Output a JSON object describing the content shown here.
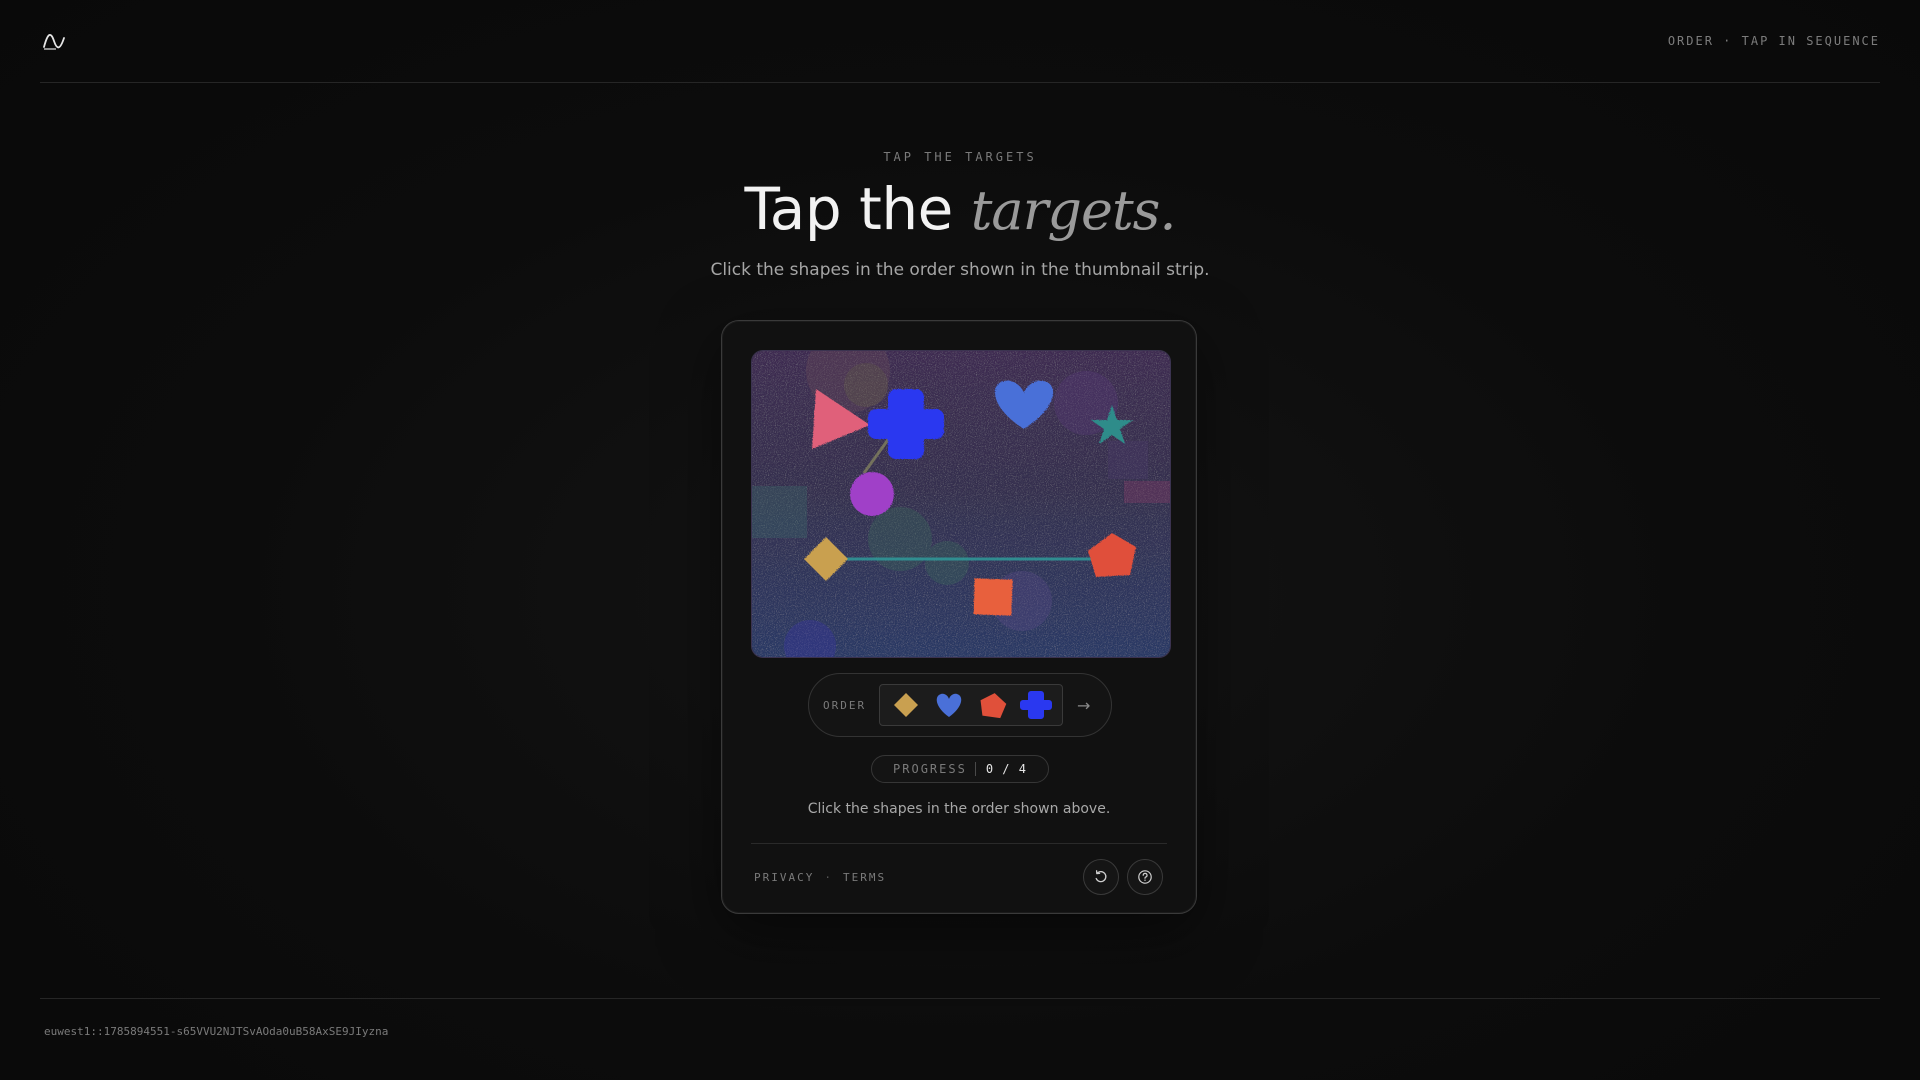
{
  "header": {
    "logo_icon": "wave-logo-icon",
    "right_label": "ORDER · TAP IN SEQUENCE"
  },
  "hero": {
    "eyebrow": "TAP THE TARGETS",
    "headline_main": "Tap the ",
    "headline_accent": "targets.",
    "subtitle": "Click the shapes in the order shown in the thumbnail strip."
  },
  "challenge": {
    "canvas_shapes": [
      {
        "shape": "triangle",
        "color": "#e0607a"
      },
      {
        "shape": "cross",
        "color": "#2a38f0"
      },
      {
        "shape": "heart",
        "color": "#4a70d8"
      },
      {
        "shape": "star",
        "color": "#2f8c8a"
      },
      {
        "shape": "circle",
        "color": "#a040c8"
      },
      {
        "shape": "diamond",
        "color": "#c9a050"
      },
      {
        "shape": "pentagon",
        "color": "#e0503a"
      },
      {
        "shape": "square",
        "color": "#e8603e"
      }
    ],
    "order_label": "ORDER",
    "order_sequence": [
      {
        "shape": "diamond",
        "color": "#c9a050"
      },
      {
        "shape": "heart",
        "color": "#4a70d8"
      },
      {
        "shape": "pentagon",
        "color": "#e0503a"
      },
      {
        "shape": "cross",
        "color": "#2a38f0"
      }
    ],
    "next_icon": "arrow-right-icon",
    "progress_label": "PROGRESS",
    "progress_value": "0 / 4",
    "instruction": "Click the shapes in the order shown above."
  },
  "card_footer": {
    "privacy": "PRIVACY",
    "separator": "·",
    "terms": "TERMS",
    "refresh_icon": "refresh-icon",
    "help_icon": "help-icon"
  },
  "footer": {
    "session_id": "euwest1::1785894551-s65VVU2NJTSvAOda0uB58AxSE9JIyzna"
  }
}
